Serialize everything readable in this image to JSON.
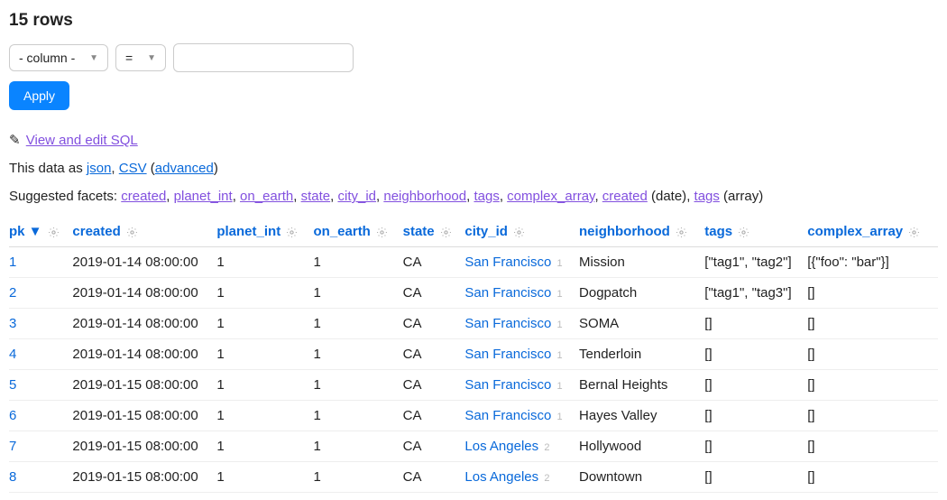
{
  "title": "15 rows",
  "filter": {
    "column_placeholder": "- column -",
    "op_placeholder": "=",
    "value": "",
    "apply_label": "Apply"
  },
  "sql": {
    "icon": "✎",
    "label": "View and edit SQL"
  },
  "export": {
    "prefix": "This data as ",
    "json": "json",
    "csv": "CSV",
    "advanced": "advanced"
  },
  "facets": {
    "prefix": "Suggested facets: ",
    "items": [
      "created",
      "planet_int",
      "on_earth",
      "state",
      "city_id",
      "neighborhood",
      "tags",
      "complex_array"
    ],
    "extra": [
      {
        "label": "created",
        "suffix": " (date)"
      },
      {
        "label": "tags",
        "suffix": " (array)"
      }
    ]
  },
  "columns": [
    {
      "key": "pk",
      "label": "pk",
      "sorted": true,
      "sort_indicator": "▼"
    },
    {
      "key": "created",
      "label": "created"
    },
    {
      "key": "planet_int",
      "label": "planet_int"
    },
    {
      "key": "on_earth",
      "label": "on_earth"
    },
    {
      "key": "state",
      "label": "state"
    },
    {
      "key": "city_id",
      "label": "city_id"
    },
    {
      "key": "neighborhood",
      "label": "neighborhood"
    },
    {
      "key": "tags",
      "label": "tags"
    },
    {
      "key": "complex_array",
      "label": "complex_array"
    }
  ],
  "rows": [
    {
      "pk": "1",
      "created": "2019-01-14 08:00:00",
      "planet_int": "1",
      "on_earth": "1",
      "state": "CA",
      "city_label": "San Francisco",
      "city_fk": "1",
      "neighborhood": "Mission",
      "tags": "[\"tag1\", \"tag2\"]",
      "complex_array": "[{\"foo\": \"bar\"}]"
    },
    {
      "pk": "2",
      "created": "2019-01-14 08:00:00",
      "planet_int": "1",
      "on_earth": "1",
      "state": "CA",
      "city_label": "San Francisco",
      "city_fk": "1",
      "neighborhood": "Dogpatch",
      "tags": "[\"tag1\", \"tag3\"]",
      "complex_array": "[]"
    },
    {
      "pk": "3",
      "created": "2019-01-14 08:00:00",
      "planet_int": "1",
      "on_earth": "1",
      "state": "CA",
      "city_label": "San Francisco",
      "city_fk": "1",
      "neighborhood": "SOMA",
      "tags": "[]",
      "complex_array": "[]"
    },
    {
      "pk": "4",
      "created": "2019-01-14 08:00:00",
      "planet_int": "1",
      "on_earth": "1",
      "state": "CA",
      "city_label": "San Francisco",
      "city_fk": "1",
      "neighborhood": "Tenderloin",
      "tags": "[]",
      "complex_array": "[]"
    },
    {
      "pk": "5",
      "created": "2019-01-15 08:00:00",
      "planet_int": "1",
      "on_earth": "1",
      "state": "CA",
      "city_label": "San Francisco",
      "city_fk": "1",
      "neighborhood": "Bernal Heights",
      "tags": "[]",
      "complex_array": "[]"
    },
    {
      "pk": "6",
      "created": "2019-01-15 08:00:00",
      "planet_int": "1",
      "on_earth": "1",
      "state": "CA",
      "city_label": "San Francisco",
      "city_fk": "1",
      "neighborhood": "Hayes Valley",
      "tags": "[]",
      "complex_array": "[]"
    },
    {
      "pk": "7",
      "created": "2019-01-15 08:00:00",
      "planet_int": "1",
      "on_earth": "1",
      "state": "CA",
      "city_label": "Los Angeles",
      "city_fk": "2",
      "neighborhood": "Hollywood",
      "tags": "[]",
      "complex_array": "[]"
    },
    {
      "pk": "8",
      "created": "2019-01-15 08:00:00",
      "planet_int": "1",
      "on_earth": "1",
      "state": "CA",
      "city_label": "Los Angeles",
      "city_fk": "2",
      "neighborhood": "Downtown",
      "tags": "[]",
      "complex_array": "[]"
    }
  ]
}
